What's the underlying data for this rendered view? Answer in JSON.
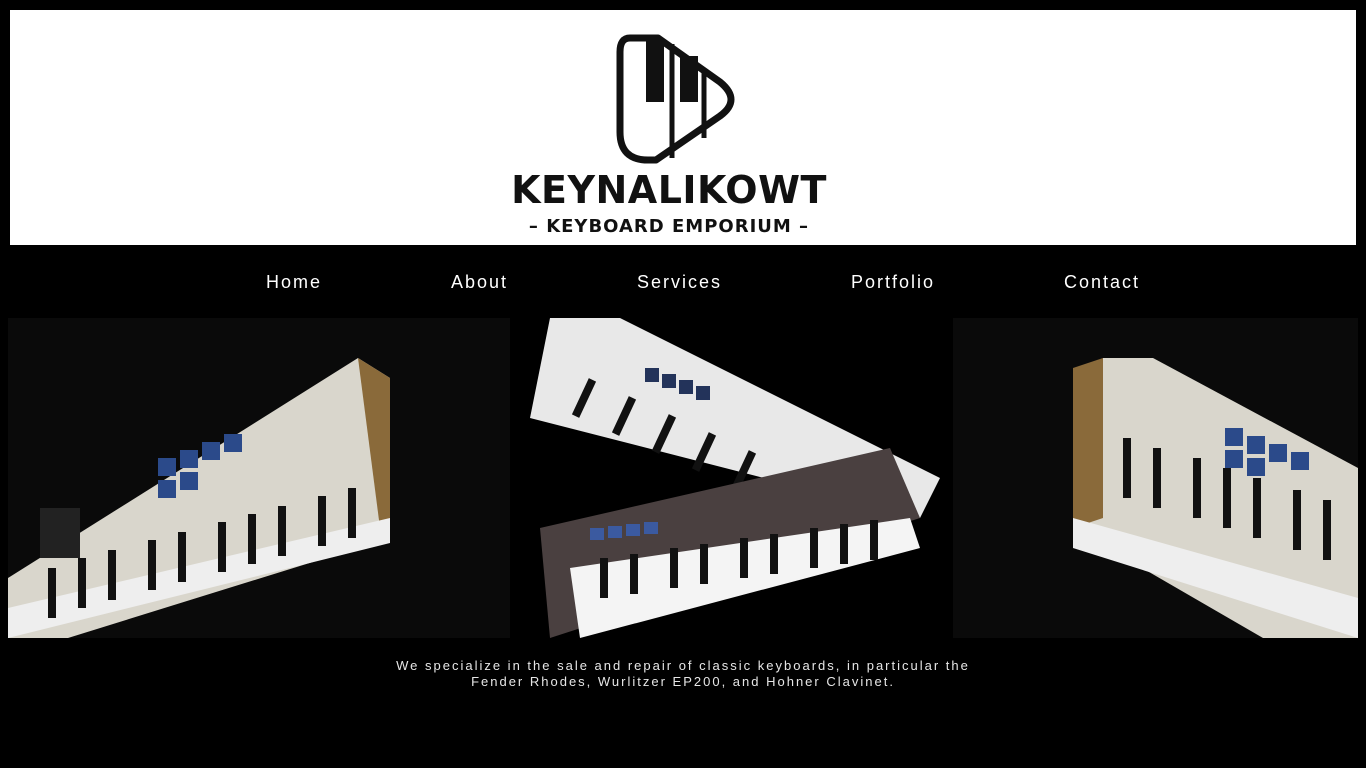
{
  "header": {
    "brand_name": "KEYNALIKOWT",
    "brand_subtitle": "– KEYBOARD EMPORIUM –",
    "logo_icon": "piano-keys-play-logo-icon"
  },
  "nav": {
    "items": [
      {
        "label": "Home"
      },
      {
        "label": "About"
      },
      {
        "label": "Services"
      },
      {
        "label": "Portfolio"
      },
      {
        "label": "Contact"
      }
    ]
  },
  "hero": {
    "images": [
      "keyboard-controller-image",
      "two-keyboard-controllers-image",
      "keyboard-controller-image"
    ]
  },
  "tagline": {
    "line1": "We specialize in the sale and repair of classic keyboards, in particular the",
    "line2": "Fender Rhodes, Wurlitzer EP200, and Hohner Clavinet."
  },
  "colors": {
    "background": "#000000",
    "header_bg": "#ffffff",
    "text": "#ffffff"
  }
}
